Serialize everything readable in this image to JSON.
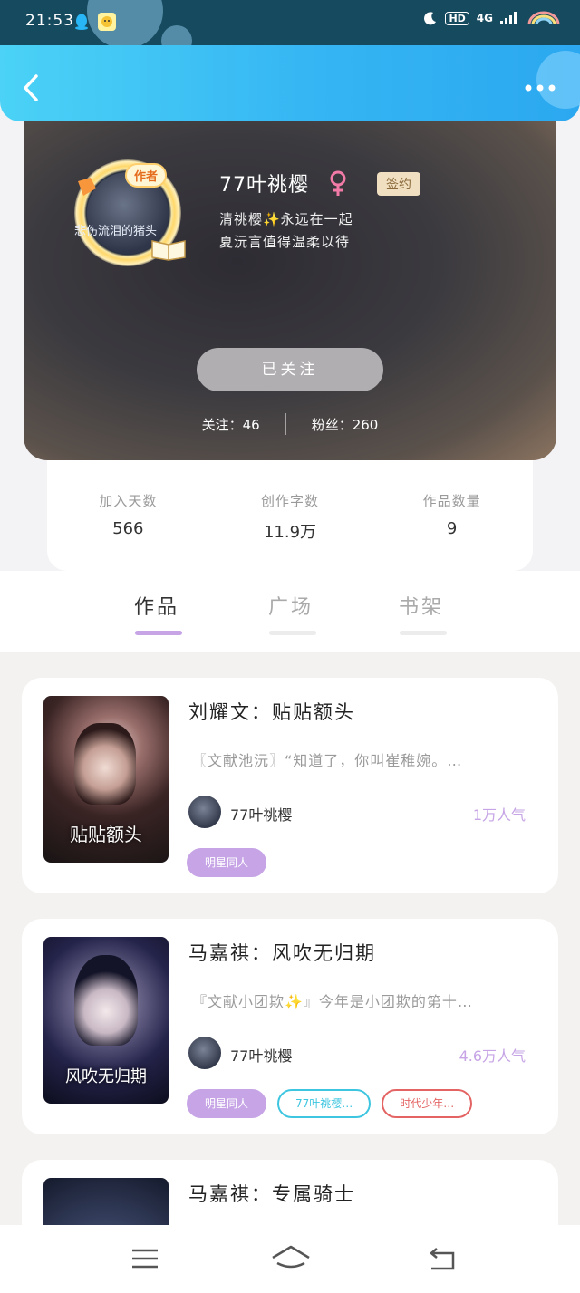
{
  "status_bar": {
    "time": "21:53",
    "network": "4G",
    "hd": "HD"
  },
  "profile": {
    "author_tag": "作者",
    "avatar_caption": "悲伤流泪的猪头",
    "nickname": "77叶祧樱",
    "signed_badge": "签约",
    "bio_line1": "清祧樱✨永远在一起",
    "bio_line2": "夏沅言值得温柔以待",
    "follow_button": "已关注",
    "following_label": "关注：46",
    "fans_label": "粉丝：260"
  },
  "stats": [
    {
      "label": "加入天数",
      "value": "566"
    },
    {
      "label": "创作字数",
      "value": "11.9万"
    },
    {
      "label": "作品数量",
      "value": "9"
    }
  ],
  "tabs": [
    {
      "label": "作品",
      "active": true
    },
    {
      "label": "广场",
      "active": false
    },
    {
      "label": "书架",
      "active": false
    }
  ],
  "works": [
    {
      "title": "刘耀文：贴贴额头",
      "description": "〖文献池沅〗“知道了，你叫崔稚婉。…",
      "author": "77叶祧樱",
      "popularity": "1万人气",
      "cover_text": "贴贴额头",
      "tags": [
        {
          "label": "明星同人",
          "style": "purple"
        }
      ]
    },
    {
      "title": "马嘉祺：风吹无归期",
      "description": "『文献小团欺✨』今年是小团欺的第十…",
      "author": "77叶祧樱",
      "popularity": "4.6万人气",
      "cover_text": "风吹无归期",
      "tags": [
        {
          "label": "明星同人",
          "style": "purple"
        },
        {
          "label": "77叶祧樱…",
          "style": "cyan"
        },
        {
          "label": "时代少年…",
          "style": "red"
        }
      ]
    },
    {
      "title": "马嘉祺：专属骑士"
    }
  ],
  "icons": {
    "back": "chevron-left-icon",
    "more": "more-dots-icon",
    "gender": "female-icon",
    "nav_menu": "menu-icon",
    "nav_home": "home-icon",
    "nav_back": "back-arrow-icon"
  },
  "colors": {
    "header_gradient_start": "#4bd2f6",
    "header_gradient_end": "#2ba8f0",
    "accent_purple": "#c6a4e6",
    "tag_cyan": "#3ec6e0",
    "tag_red": "#e46464",
    "female_pink": "#f27aa6"
  }
}
